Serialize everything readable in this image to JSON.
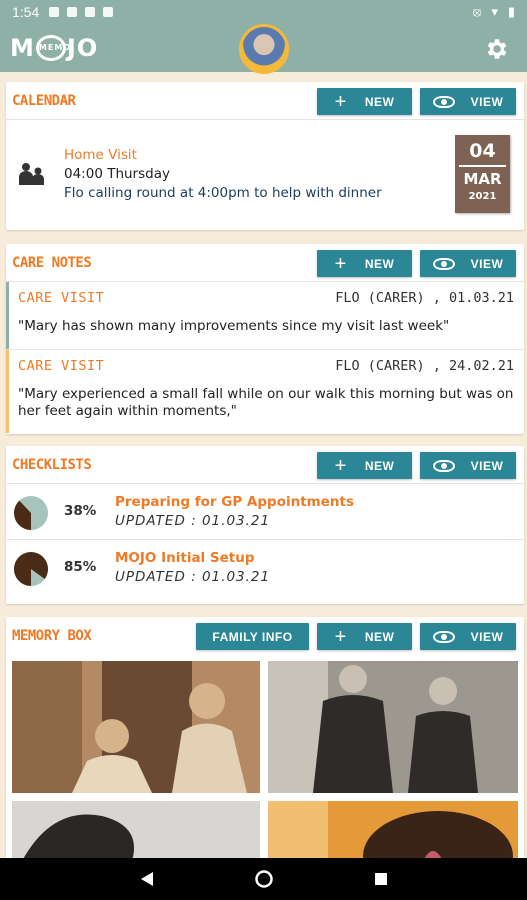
{
  "status_bar": {
    "time": "1:54"
  },
  "app": {
    "logo_text": "M JO",
    "logo_badge": "MEMO"
  },
  "calendar": {
    "title": "CALENDAR",
    "new_label": "NEW",
    "view_label": "VIEW",
    "event": {
      "type": "Home Visit",
      "when": "04:00 Thursday",
      "description": "Flo calling round at 4:00pm to help with dinner",
      "day": "04",
      "month": "MAR",
      "year": "2021"
    }
  },
  "care_notes": {
    "title": "CARE NOTES",
    "new_label": "NEW",
    "view_label": "VIEW",
    "notes": [
      {
        "type": "CARE VISIT",
        "meta": "FLO (CARER) , 01.03.21",
        "text": "\"Mary has shown many improvements since my visit last week\""
      },
      {
        "type": "CARE VISIT",
        "meta": "FLO (CARER) , 24.02.21",
        "text": "\"Mary experienced a small fall while on our walk this morning but was on her feet again within moments,\""
      }
    ]
  },
  "checklists": {
    "title": "CHECKLISTS",
    "new_label": "NEW",
    "view_label": "VIEW",
    "items": [
      {
        "percent_label": "38%",
        "progress": 0.38,
        "title": "Preparing for GP Appointments",
        "updated": "UPDATED : 01.03.21"
      },
      {
        "percent_label": "85%",
        "progress": 0.85,
        "title": "MOJO Initial Setup",
        "updated": "UPDATED : 01.03.21"
      }
    ]
  },
  "memory_box": {
    "title": "MEMORY BOX",
    "family_label": "FAMILY INFO",
    "new_label": "NEW",
    "view_label": "VIEW"
  },
  "colors": {
    "accent": "#ef7a25",
    "teal": "#2b8796",
    "appbar": "#8fb0a6",
    "brown": "#7e6253"
  }
}
